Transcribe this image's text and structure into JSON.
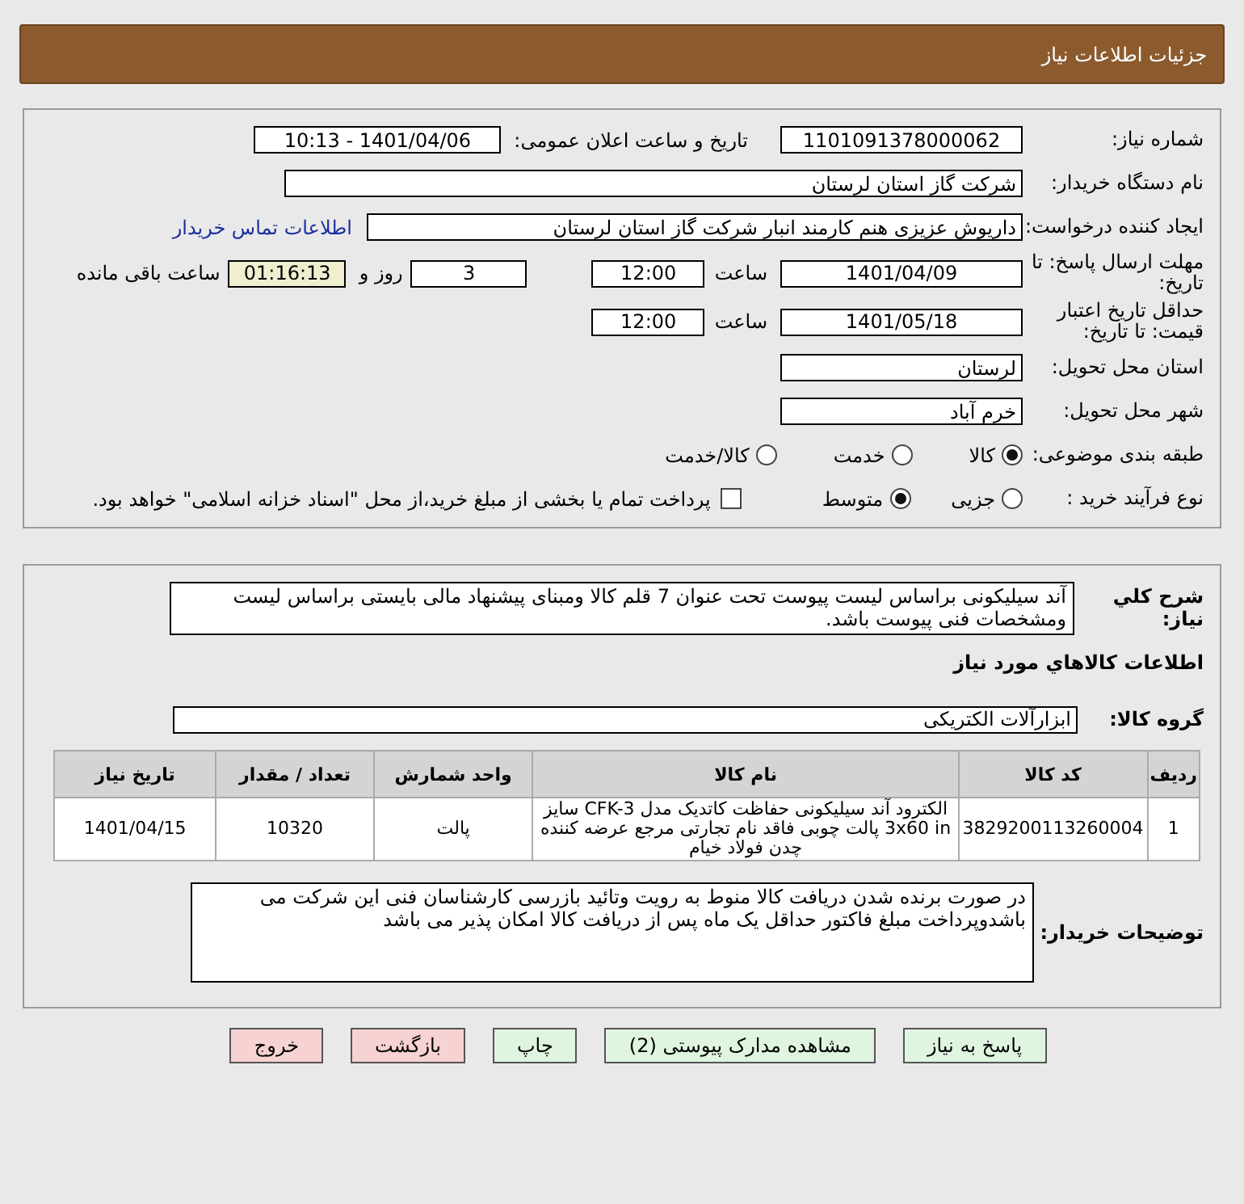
{
  "header": {
    "title": "جزئیات اطلاعات نیاز"
  },
  "need_number": {
    "label": "شماره نیاز:",
    "value": "1101091378000062"
  },
  "announce": {
    "label": "تاریخ و ساعت اعلان عمومی:",
    "value": "1401/04/06 - 10:13"
  },
  "buyer": {
    "label": "نام دستگاه خریدار:",
    "value": "شرکت گاز استان لرستان"
  },
  "requester": {
    "label": "ایجاد کننده درخواست:",
    "value": "داریوش عزیزی هنم کارمند انبار شرکت گاز استان لرستان",
    "link": "اطلاعات تماس خریدار"
  },
  "deadline": {
    "label": "مهلت ارسال پاسخ: تا تاریخ:",
    "date": "1401/04/09",
    "time_label": "ساعت",
    "time": "12:00",
    "days": "3",
    "days_label": "روز و",
    "remaining": "01:16:13",
    "remaining_label": "ساعت باقی مانده"
  },
  "validity": {
    "label": "حداقل تاریخ اعتبار قیمت: تا تاریخ:",
    "date": "1401/05/18",
    "time_label": "ساعت",
    "time": "12:00"
  },
  "province": {
    "label": "استان محل تحویل:",
    "value": "لرستان"
  },
  "city": {
    "label": "شهر محل تحویل:",
    "value": "خرم آباد"
  },
  "category": {
    "label": "طبقه بندی موضوعی:",
    "options": [
      {
        "label": "کالا",
        "selected": true
      },
      {
        "label": "خدمت",
        "selected": false
      },
      {
        "label": "کالا/خدمت",
        "selected": false
      }
    ]
  },
  "process": {
    "label": "نوع فرآیند خرید :",
    "options": [
      {
        "label": "جزیی",
        "selected": false
      },
      {
        "label": "متوسط",
        "selected": true
      }
    ],
    "payment": {
      "label": "پرداخت تمام یا بخشی از مبلغ خرید،از محل \"اسناد خزانه اسلامی\" خواهد بود.",
      "checked": false
    }
  },
  "description": {
    "label": "شرح کلي نياز:",
    "value": "آند سیلیکونی براساس لیست پیوست تحت عنوان 7 قلم کالا ومبنای پیشنهاد مالی بایستی براساس لیست ومشخصات  فنی پیوست  باشد."
  },
  "items_title": "اطلاعات کالاهاي مورد نياز",
  "goods_group": {
    "label": "گروه کالا:",
    "value": "ابزارآلات الکتریکی"
  },
  "table": {
    "columns": [
      "ردیف",
      "کد کالا",
      "نام کالا",
      "واحد شمارش",
      "تعداد / مقدار",
      "تاریخ نیاز"
    ],
    "rows": [
      [
        "1",
        "3829200113260004",
        "الکترود آند سیلیکونی حفاظت کاتدیک مدل CFK-3 سایز 3x60 in پالت چوبی فاقد نام تجارتی مرجع عرضه کننده چدن فولاد خیام",
        "پالت",
        "10320",
        "1401/04/15"
      ]
    ]
  },
  "buyer_notes": {
    "label": "توضیحات خریدار:",
    "value": "در  صورت برنده شدن دریافت کالا منوط به رویت وتائید بازرسی کارشناسان فنی این شرکت می باشدوپرداخت مبلغ فاکتور حداقل یک ماه پس از دریافت کالا امکان پذیر می باشد"
  },
  "buttons": [
    {
      "label": "پاسخ به نیاز",
      "kind": "primary"
    },
    {
      "label": "مشاهده مدارک پیوستی (2)",
      "kind": "primary"
    },
    {
      "label": "چاپ",
      "kind": "primary"
    },
    {
      "label": "بازگشت",
      "kind": "danger"
    },
    {
      "label": "خروج",
      "kind": "danger"
    }
  ]
}
